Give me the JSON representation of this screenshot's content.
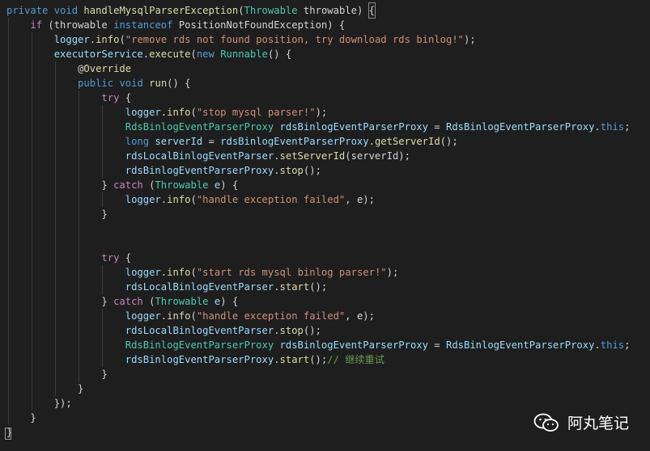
{
  "editor": {
    "lines": [
      [
        {
          "t": "private",
          "c": "kw"
        },
        {
          "t": " ",
          "c": "plain"
        },
        {
          "t": "void",
          "c": "kw"
        },
        {
          "t": " ",
          "c": "plain"
        },
        {
          "t": "handleMysqlParserException",
          "c": "fn"
        },
        {
          "t": "(",
          "c": "plain"
        },
        {
          "t": "Throwable",
          "c": "type"
        },
        {
          "t": " throwable) ",
          "c": "plain"
        },
        {
          "t": "{",
          "c": "plain hl"
        }
      ],
      [
        {
          "t": "    ",
          "c": "plain"
        },
        {
          "t": "if",
          "c": "ctl"
        },
        {
          "t": " (throwable ",
          "c": "plain"
        },
        {
          "t": "instanceof",
          "c": "kw"
        },
        {
          "t": " PositionNotFoundException) {",
          "c": "plain"
        }
      ],
      [
        {
          "t": "        ",
          "c": "plain"
        },
        {
          "t": "logger",
          "c": "var"
        },
        {
          "t": ".",
          "c": "plain"
        },
        {
          "t": "info",
          "c": "fn"
        },
        {
          "t": "(",
          "c": "plain"
        },
        {
          "t": "\"remove rds not found position, try download rds binlog!\"",
          "c": "str"
        },
        {
          "t": ");",
          "c": "plain"
        }
      ],
      [
        {
          "t": "        ",
          "c": "plain"
        },
        {
          "t": "executorService",
          "c": "var"
        },
        {
          "t": ".",
          "c": "plain"
        },
        {
          "t": "execute",
          "c": "fn"
        },
        {
          "t": "(",
          "c": "plain"
        },
        {
          "t": "new",
          "c": "kw"
        },
        {
          "t": " ",
          "c": "plain"
        },
        {
          "t": "Runnable",
          "c": "type"
        },
        {
          "t": "() {",
          "c": "plain"
        }
      ],
      [
        {
          "t": "            ",
          "c": "plain"
        },
        {
          "t": "@",
          "c": "plain"
        },
        {
          "t": "Override",
          "c": "ann"
        }
      ],
      [
        {
          "t": "            ",
          "c": "plain"
        },
        {
          "t": "public",
          "c": "kw"
        },
        {
          "t": " ",
          "c": "plain"
        },
        {
          "t": "void",
          "c": "kw"
        },
        {
          "t": " ",
          "c": "plain"
        },
        {
          "t": "run",
          "c": "fn"
        },
        {
          "t": "() {",
          "c": "plain"
        }
      ],
      [
        {
          "t": "                ",
          "c": "plain"
        },
        {
          "t": "try",
          "c": "ctl"
        },
        {
          "t": " {",
          "c": "plain"
        }
      ],
      [
        {
          "t": "                    ",
          "c": "plain"
        },
        {
          "t": "logger",
          "c": "var"
        },
        {
          "t": ".",
          "c": "plain"
        },
        {
          "t": "info",
          "c": "fn"
        },
        {
          "t": "(",
          "c": "plain"
        },
        {
          "t": "\"stop mysql parser!\"",
          "c": "str"
        },
        {
          "t": ");",
          "c": "plain"
        }
      ],
      [
        {
          "t": "                    ",
          "c": "plain"
        },
        {
          "t": "RdsBinlogEventParserProxy",
          "c": "type"
        },
        {
          "t": " ",
          "c": "plain"
        },
        {
          "t": "rdsBinlogEventParserProxy",
          "c": "var"
        },
        {
          "t": " = ",
          "c": "plain"
        },
        {
          "t": "RdsBinlogEventParserProxy",
          "c": "var"
        },
        {
          "t": ".",
          "c": "plain"
        },
        {
          "t": "this",
          "c": "kw"
        },
        {
          "t": ";",
          "c": "plain"
        }
      ],
      [
        {
          "t": "                    ",
          "c": "plain"
        },
        {
          "t": "long",
          "c": "kw"
        },
        {
          "t": " ",
          "c": "plain"
        },
        {
          "t": "serverId",
          "c": "var"
        },
        {
          "t": " = ",
          "c": "plain"
        },
        {
          "t": "rdsBinlogEventParserProxy",
          "c": "var"
        },
        {
          "t": ".",
          "c": "plain"
        },
        {
          "t": "getServerId",
          "c": "fn"
        },
        {
          "t": "();",
          "c": "plain"
        }
      ],
      [
        {
          "t": "                    ",
          "c": "plain"
        },
        {
          "t": "rdsLocalBinlogEventParser",
          "c": "var"
        },
        {
          "t": ".",
          "c": "plain"
        },
        {
          "t": "setServerId",
          "c": "fn"
        },
        {
          "t": "(serverId);",
          "c": "plain"
        }
      ],
      [
        {
          "t": "                    ",
          "c": "plain"
        },
        {
          "t": "rdsBinlogEventParserProxy",
          "c": "var"
        },
        {
          "t": ".",
          "c": "plain"
        },
        {
          "t": "stop",
          "c": "fn"
        },
        {
          "t": "();",
          "c": "plain"
        }
      ],
      [
        {
          "t": "                } ",
          "c": "plain"
        },
        {
          "t": "catch",
          "c": "ctl"
        },
        {
          "t": " (",
          "c": "plain"
        },
        {
          "t": "Throwable",
          "c": "type"
        },
        {
          "t": " ",
          "c": "plain"
        },
        {
          "t": "e",
          "c": "var"
        },
        {
          "t": ") {",
          "c": "plain"
        }
      ],
      [
        {
          "t": "                    ",
          "c": "plain"
        },
        {
          "t": "logger",
          "c": "var"
        },
        {
          "t": ".",
          "c": "plain"
        },
        {
          "t": "info",
          "c": "fn"
        },
        {
          "t": "(",
          "c": "plain"
        },
        {
          "t": "\"handle exception failed\"",
          "c": "str"
        },
        {
          "t": ", e);",
          "c": "plain"
        }
      ],
      [
        {
          "t": "                }",
          "c": "plain"
        }
      ],
      [
        {
          "t": "",
          "c": "plain"
        }
      ],
      [
        {
          "t": "",
          "c": "plain"
        }
      ],
      [
        {
          "t": "                ",
          "c": "plain"
        },
        {
          "t": "try",
          "c": "ctl"
        },
        {
          "t": " {",
          "c": "plain"
        }
      ],
      [
        {
          "t": "                    ",
          "c": "plain"
        },
        {
          "t": "logger",
          "c": "var"
        },
        {
          "t": ".",
          "c": "plain"
        },
        {
          "t": "info",
          "c": "fn"
        },
        {
          "t": "(",
          "c": "plain"
        },
        {
          "t": "\"start rds mysql binlog parser!\"",
          "c": "str"
        },
        {
          "t": ");",
          "c": "plain"
        }
      ],
      [
        {
          "t": "                    ",
          "c": "plain"
        },
        {
          "t": "rdsLocalBinlogEventParser",
          "c": "var"
        },
        {
          "t": ".",
          "c": "plain"
        },
        {
          "t": "start",
          "c": "fn"
        },
        {
          "t": "();",
          "c": "plain"
        }
      ],
      [
        {
          "t": "                } ",
          "c": "plain"
        },
        {
          "t": "catch",
          "c": "ctl"
        },
        {
          "t": " (",
          "c": "plain"
        },
        {
          "t": "Throwable",
          "c": "type"
        },
        {
          "t": " ",
          "c": "plain"
        },
        {
          "t": "e",
          "c": "var"
        },
        {
          "t": ") {",
          "c": "plain"
        }
      ],
      [
        {
          "t": "                    ",
          "c": "plain"
        },
        {
          "t": "logger",
          "c": "var"
        },
        {
          "t": ".",
          "c": "plain"
        },
        {
          "t": "info",
          "c": "fn"
        },
        {
          "t": "(",
          "c": "plain"
        },
        {
          "t": "\"handle exception failed\"",
          "c": "str"
        },
        {
          "t": ", e);",
          "c": "plain"
        }
      ],
      [
        {
          "t": "                    ",
          "c": "plain"
        },
        {
          "t": "rdsLocalBinlogEventParser",
          "c": "var"
        },
        {
          "t": ".",
          "c": "plain"
        },
        {
          "t": "stop",
          "c": "fn"
        },
        {
          "t": "();",
          "c": "plain"
        }
      ],
      [
        {
          "t": "                    ",
          "c": "plain"
        },
        {
          "t": "RdsBinlogEventParserProxy",
          "c": "type"
        },
        {
          "t": " ",
          "c": "plain"
        },
        {
          "t": "rdsBinlogEventParserProxy",
          "c": "var"
        },
        {
          "t": " = ",
          "c": "plain"
        },
        {
          "t": "RdsBinlogEventParserProxy",
          "c": "var"
        },
        {
          "t": ".",
          "c": "plain"
        },
        {
          "t": "this",
          "c": "kw"
        },
        {
          "t": ";",
          "c": "plain"
        }
      ],
      [
        {
          "t": "                    ",
          "c": "plain"
        },
        {
          "t": "rdsBinlogEventParserProxy",
          "c": "var"
        },
        {
          "t": ".",
          "c": "plain"
        },
        {
          "t": "start",
          "c": "fn"
        },
        {
          "t": "();",
          "c": "plain"
        },
        {
          "t": "// 继续重试",
          "c": "cmt"
        }
      ],
      [
        {
          "t": "                }",
          "c": "plain"
        }
      ],
      [
        {
          "t": "            }",
          "c": "plain"
        }
      ],
      [
        {
          "t": "        });",
          "c": "plain"
        }
      ],
      [
        {
          "t": "    }",
          "c": "plain"
        }
      ],
      [
        {
          "t": "}",
          "c": "plain"
        }
      ]
    ]
  },
  "watermark": {
    "text": "阿丸笔记",
    "icon": "wechat-icon"
  }
}
